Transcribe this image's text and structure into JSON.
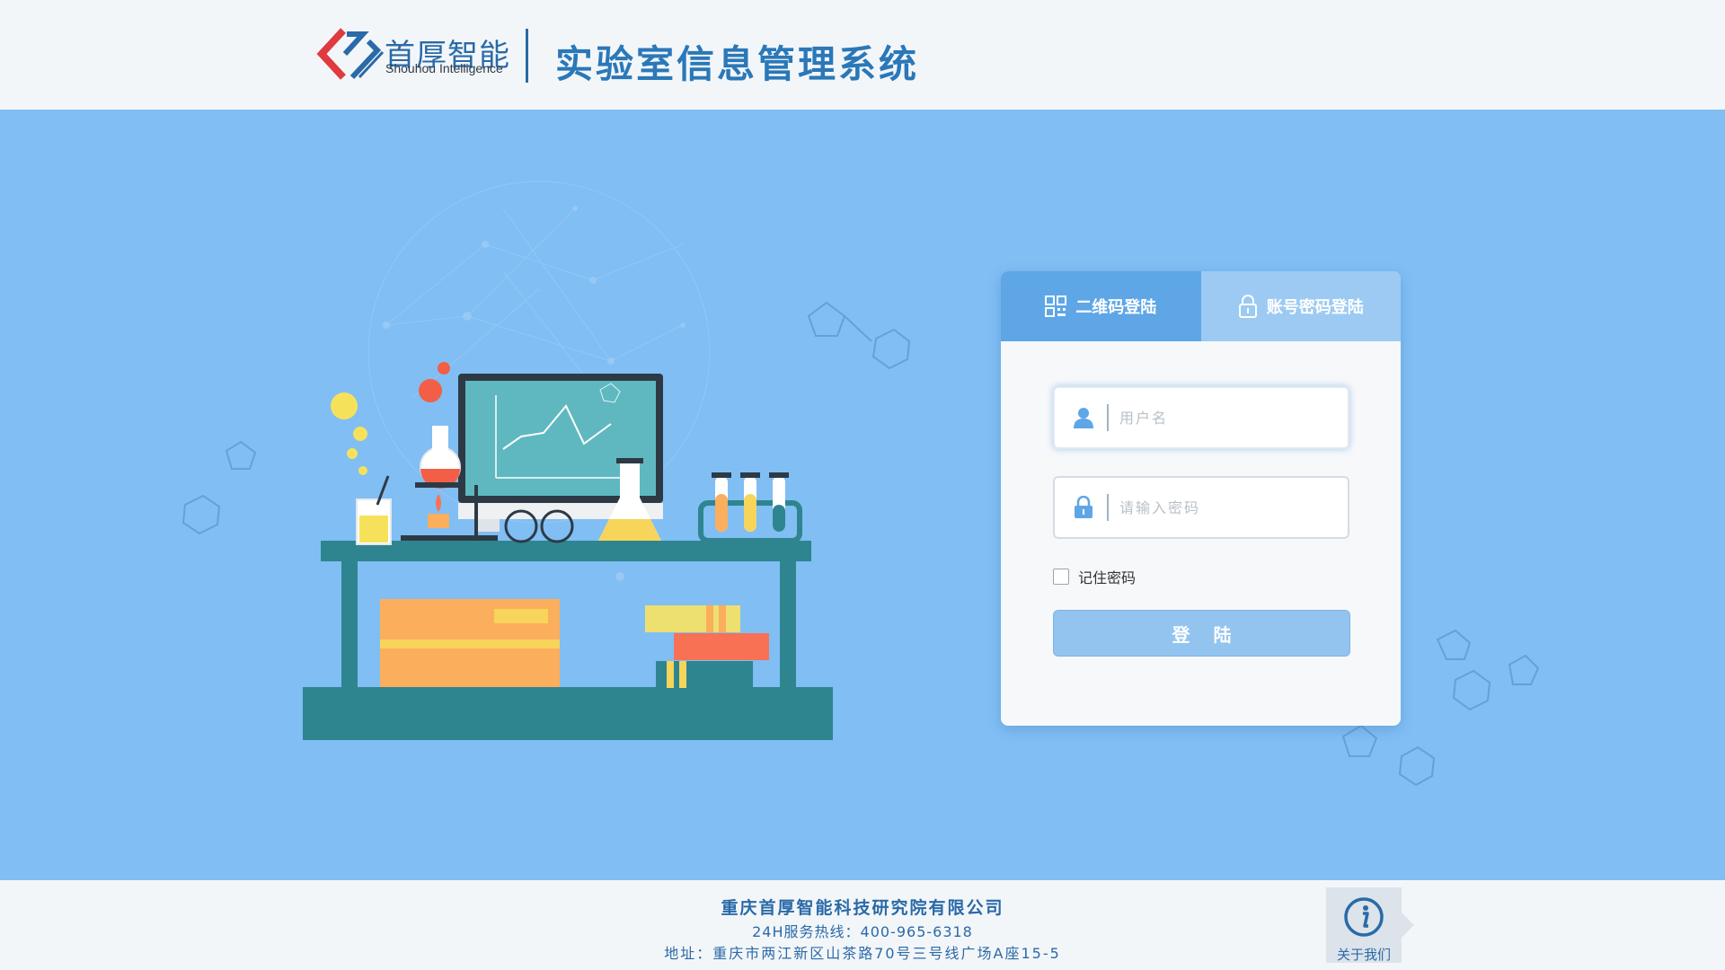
{
  "header": {
    "brand_cn": "首厚智能",
    "brand_en": "Shouhou Intelligence",
    "system_title": "实验室信息管理系统"
  },
  "login": {
    "tabs": [
      {
        "label": "二维码登陆",
        "icon": "qr-code-icon",
        "active": true
      },
      {
        "label": "账号密码登陆",
        "icon": "lock-icon",
        "active": false
      }
    ],
    "username_placeholder": "用户名",
    "password_placeholder": "请输入密码",
    "remember_label": "记住密码",
    "remember_checked": false,
    "submit_label": "登陆"
  },
  "footer": {
    "company": "重庆首厚智能科技研究院有限公司",
    "hotline": "24H服务热线：400-965-6318",
    "address": "地址：重庆市两江新区山茶路70号三号线广场A座15-5",
    "about_label": "关于我们"
  },
  "colors": {
    "banner_bg": "#80bef4",
    "brand_blue": "#2a6aa8",
    "tab_active": "#5ea6e6",
    "tab_inactive": "#9ccaf2",
    "login_button": "#93c4f0",
    "logo_red": "#e03a3e"
  }
}
